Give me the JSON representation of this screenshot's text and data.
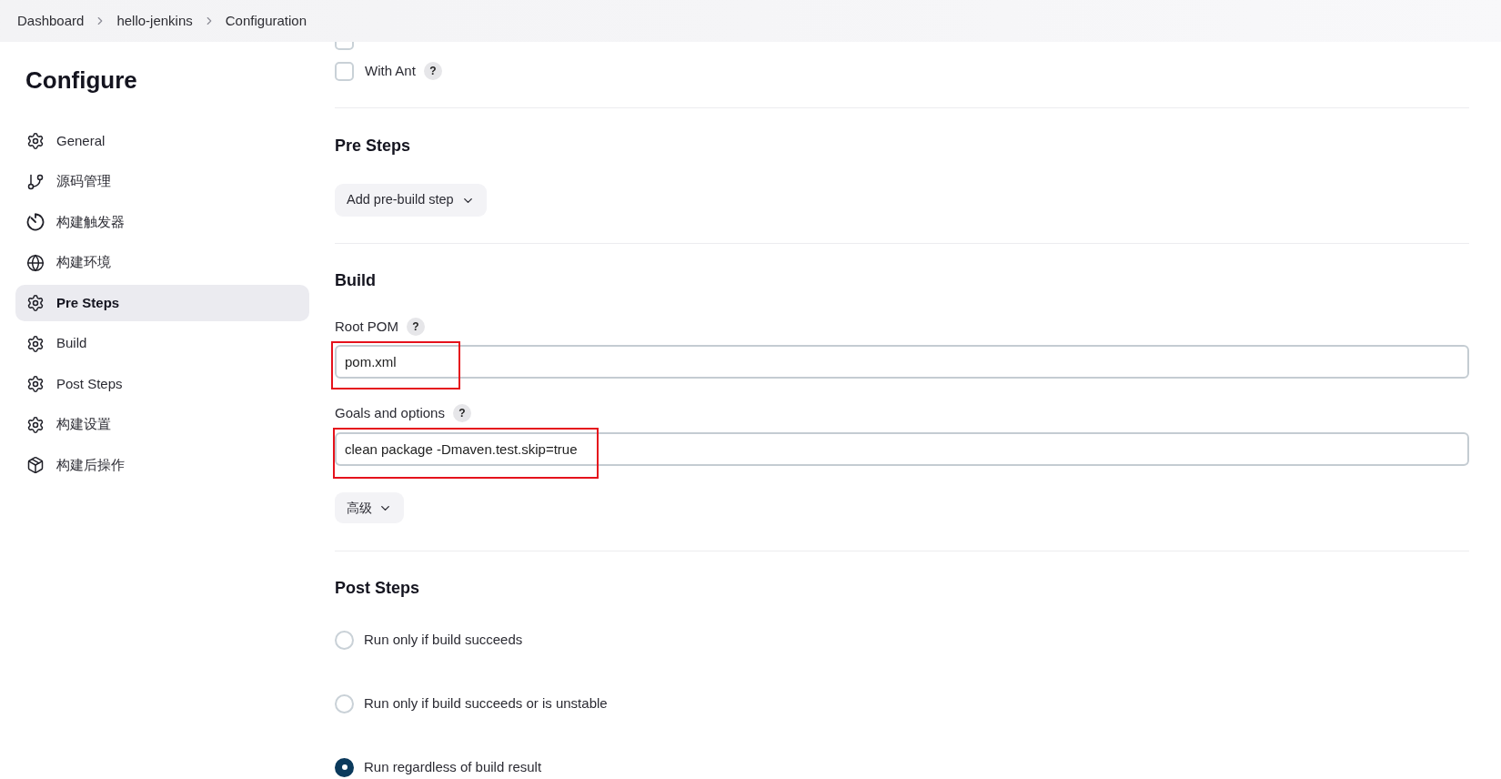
{
  "breadcrumbs": [
    {
      "label": "Dashboard"
    },
    {
      "label": "hello-jenkins"
    },
    {
      "label": "Configuration"
    }
  ],
  "sidebar": {
    "title": "Configure",
    "items": [
      {
        "label": "General",
        "kind": "gear",
        "selected": false
      },
      {
        "label": "源码管理",
        "kind": "branch",
        "selected": false
      },
      {
        "label": "构建触发器",
        "kind": "timer",
        "selected": false
      },
      {
        "label": "构建环境",
        "kind": "globe",
        "selected": false
      },
      {
        "label": "Pre Steps",
        "kind": "gear",
        "selected": true
      },
      {
        "label": "Build",
        "kind": "gear",
        "selected": false
      },
      {
        "label": "Post Steps",
        "kind": "gear",
        "selected": false
      },
      {
        "label": "构建设置",
        "kind": "gear",
        "selected": false
      },
      {
        "label": "构建后操作",
        "kind": "box",
        "selected": false
      }
    ]
  },
  "options": [
    {
      "checked": false
    },
    {
      "label": "With Ant",
      "checked": false,
      "help": "?"
    }
  ],
  "pre_steps": {
    "title": "Pre Steps",
    "button": "Add pre-build step"
  },
  "build": {
    "title": "Build",
    "fields": [
      {
        "label": "Root POM",
        "help": "?",
        "value": "pom.xml",
        "highlighted": true
      },
      {
        "label": "Goals and options",
        "help": "?",
        "value": "clean package -Dmaven.test.skip=true",
        "highlighted": true
      }
    ],
    "advanced_button": "高级"
  },
  "post_steps": {
    "title": "Post Steps",
    "options": [
      {
        "label": "Run only if build succeeds",
        "selected": false
      },
      {
        "label": "Run only if build succeeds or is unstable",
        "selected": false
      },
      {
        "label": "Run regardless of build result",
        "selected": true
      }
    ]
  }
}
